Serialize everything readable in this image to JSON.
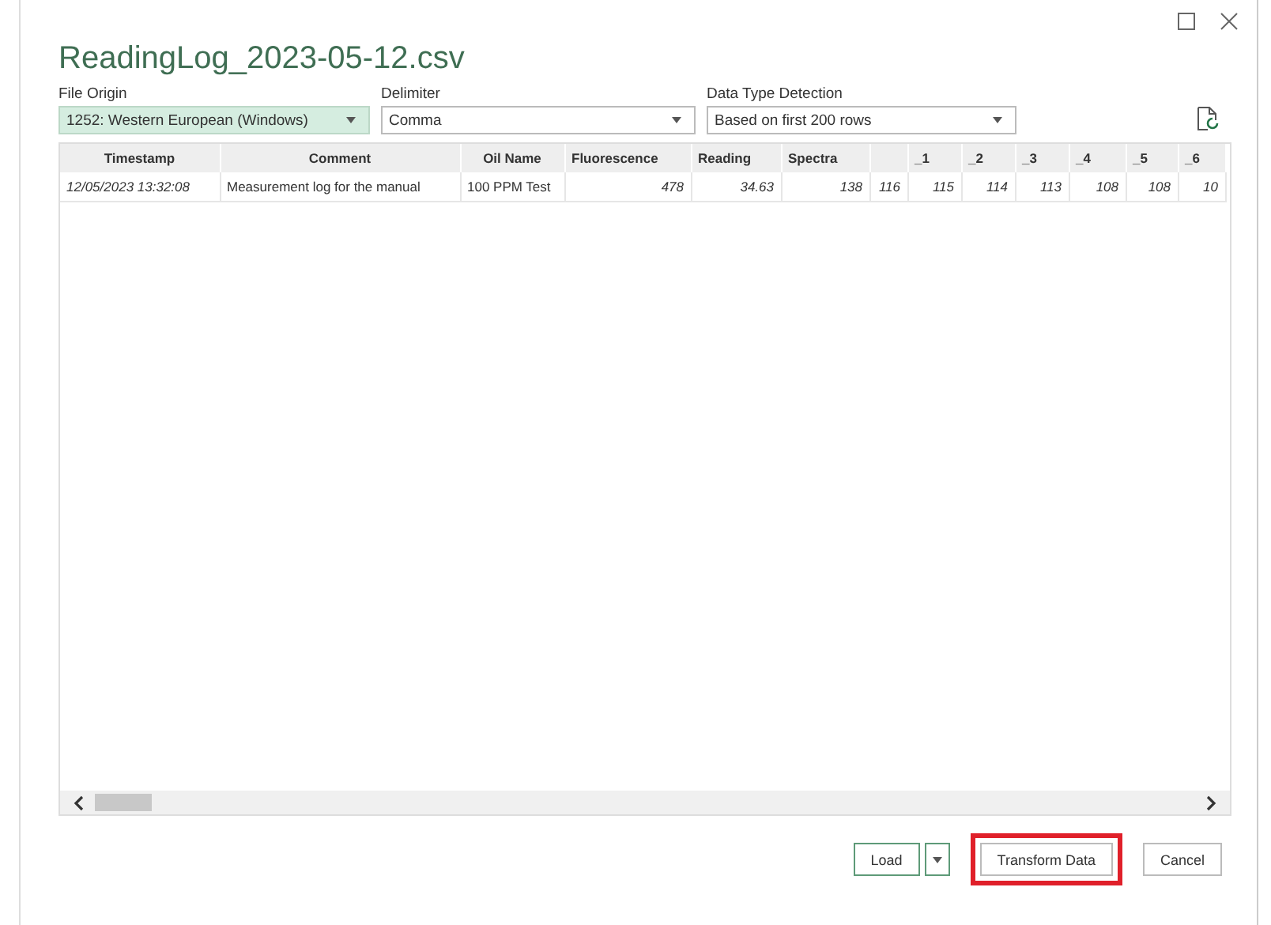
{
  "window": {
    "title": "ReadingLog_2023-05-12.csv"
  },
  "options": [
    {
      "label": "File Origin",
      "value": "1252: Western European (Windows)",
      "focused": true
    },
    {
      "label": "Delimiter",
      "value": "Comma",
      "focused": false
    },
    {
      "label": "Data Type Detection",
      "value": "Based on first 200 rows",
      "focused": false
    }
  ],
  "table": {
    "columns": [
      {
        "label": "Timestamp"
      },
      {
        "label": "Comment"
      },
      {
        "label": "Oil Name"
      },
      {
        "label": "Fluorescence"
      },
      {
        "label": "Reading"
      },
      {
        "label": "Spectra"
      },
      {},
      {
        "label": "_1"
      },
      {
        "label": "_2"
      },
      {
        "label": "_3"
      },
      {
        "label": "_4"
      },
      {
        "label": "_5"
      },
      {
        "label": "_6"
      }
    ],
    "rows": [
      [
        "12/05/2023 13:32:08",
        "Measurement log for the manual",
        "100 PPM Test",
        "478",
        "34.63",
        "138",
        "116",
        "115",
        "114",
        "113",
        "108",
        "108",
        "10"
      ]
    ]
  },
  "buttons": [
    {
      "label": "Load",
      "kind": "split",
      "highlighted": false
    },
    {
      "label": "Transform Data",
      "kind": "plain",
      "highlighted": true
    },
    {
      "label": "Cancel",
      "kind": "plain",
      "highlighted": false
    }
  ]
}
